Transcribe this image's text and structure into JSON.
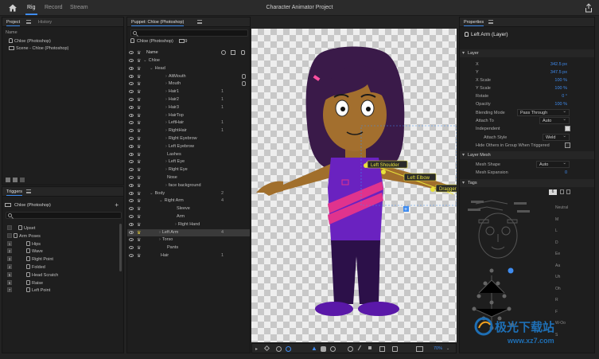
{
  "app": {
    "title": "Character Animator Project",
    "tabs": [
      "Rig",
      "Record",
      "Stream"
    ],
    "active_tab": "Rig"
  },
  "project": {
    "tabs": [
      "Project",
      "History"
    ],
    "name_header": "Name",
    "items": [
      "Chloe (Photoshop)",
      "Scene - Chloe (Photoshop)"
    ]
  },
  "triggers": {
    "title": "Triggers",
    "puppet": "Chloe (Photoshop)",
    "rows": [
      {
        "key": "",
        "label": "Upset",
        "indent": 20
      },
      {
        "key": "",
        "label": "Arm Poses",
        "indent": 14,
        "group": true
      },
      {
        "key": "1",
        "label": "Hips",
        "indent": 30
      },
      {
        "key": "2",
        "label": "Wave",
        "indent": 30
      },
      {
        "key": "3",
        "label": "Right Point",
        "indent": 30
      },
      {
        "key": "4",
        "label": "Folded",
        "indent": 30
      },
      {
        "key": "5",
        "label": "Head Scratch",
        "indent": 30
      },
      {
        "key": "6",
        "label": "Raise",
        "indent": 30
      },
      {
        "key": "7",
        "label": "Left Point",
        "indent": 30
      }
    ]
  },
  "puppet": {
    "title": "Puppet: Chloe (Photoshop)",
    "crumb": "Chloe (Photoshop)",
    "crumb_count": "9",
    "name_header": "Name",
    "layers": [
      {
        "name": "Chloe",
        "indent": 20,
        "arrow": "⌄",
        "num": ""
      },
      {
        "name": "Head",
        "indent": 28,
        "arrow": "⌄",
        "num": ""
      },
      {
        "name": "AltMouth",
        "indent": 48,
        "arrow": "›",
        "num": "",
        "rbtn": true
      },
      {
        "name": "Mouth",
        "indent": 48,
        "arrow": "›",
        "num": "",
        "rbtn": true
      },
      {
        "name": "Hair1",
        "indent": 48,
        "arrow": "›",
        "num": "1"
      },
      {
        "name": "Hair2",
        "indent": 48,
        "arrow": "›",
        "num": "1"
      },
      {
        "name": "Hair3",
        "indent": 48,
        "arrow": "›",
        "num": "1"
      },
      {
        "name": "HairTop",
        "indent": 48,
        "arrow": "›",
        "num": ""
      },
      {
        "name": "LeftHair",
        "indent": 48,
        "arrow": "›",
        "num": "1"
      },
      {
        "name": "RightHair",
        "indent": 48,
        "arrow": "›",
        "num": "1"
      },
      {
        "name": "Right Eyebrow",
        "indent": 48,
        "arrow": "›",
        "num": ""
      },
      {
        "name": "Left Eyebrow",
        "indent": 48,
        "arrow": "›",
        "num": ""
      },
      {
        "name": "Lashes",
        "indent": 48,
        "arrow": "",
        "num": ""
      },
      {
        "name": "Left Eye",
        "indent": 48,
        "arrow": "›",
        "num": ""
      },
      {
        "name": "Right Eye",
        "indent": 48,
        "arrow": "›",
        "num": ""
      },
      {
        "name": "Nose",
        "indent": 48,
        "arrow": "",
        "num": ""
      },
      {
        "name": "face background",
        "indent": 48,
        "arrow": "›",
        "num": ""
      },
      {
        "name": "Body",
        "indent": 28,
        "arrow": "⌄",
        "num": "2"
      },
      {
        "name": "Right Arm",
        "indent": 40,
        "arrow": "⌄",
        "num": "4"
      },
      {
        "name": "Sleeve",
        "indent": 60,
        "arrow": "",
        "num": ""
      },
      {
        "name": "Arm",
        "indent": 60,
        "arrow": "",
        "num": ""
      },
      {
        "name": "Right Hand",
        "indent": 60,
        "arrow": "›",
        "num": ""
      },
      {
        "name": "Left Arm",
        "indent": 40,
        "arrow": "›",
        "num": "4",
        "selected": true
      },
      {
        "name": "Torso",
        "indent": 40,
        "arrow": "›",
        "num": ""
      },
      {
        "name": "Pants",
        "indent": 48,
        "arrow": "",
        "num": ""
      },
      {
        "name": "Hair",
        "indent": 40,
        "arrow": "",
        "num": "1"
      }
    ]
  },
  "scene": {
    "handles": [
      "Left Shoulder",
      "Left Elbow",
      "Dragger"
    ],
    "zoom": "70%"
  },
  "properties": {
    "tab": "Properties",
    "layer_title": "Left Arm (Layer)",
    "layer_section": "Layer",
    "rows": [
      {
        "label": "X",
        "value": "342.5 px"
      },
      {
        "label": "Y",
        "value": "347.5 px"
      },
      {
        "label": "X Scale",
        "value": "100 %"
      },
      {
        "label": "Y Scale",
        "value": "100 %"
      },
      {
        "label": "Rotate",
        "value": "0 °"
      },
      {
        "label": "Opacity",
        "value": "100 %"
      }
    ],
    "blending_mode_label": "Blending Mode",
    "blending_mode": "Pass Through",
    "attach_to_label": "Attach To",
    "attach_to": "Auto",
    "independent_label": "Independent",
    "attach_style_label": "Attach Style",
    "attach_style": "Weld",
    "hide_others_label": "Hide Others in Group When Triggered",
    "mesh_section": "Layer Mesh",
    "mesh_shape_label": "Mesh Shape",
    "mesh_shape": "Auto",
    "mesh_expansion_label": "Mesh Expansion",
    "mesh_expansion": "0",
    "tags_section": "Tags",
    "tag_count": "6",
    "tag_labels": [
      "Neutral",
      "M",
      "L",
      "D",
      "Ee",
      "Aa",
      "Uh",
      "Oh",
      "R",
      "F",
      "W-Oo",
      "S"
    ]
  },
  "watermark": {
    "line1": "极光下载站",
    "line2": "www.xz7.com"
  }
}
